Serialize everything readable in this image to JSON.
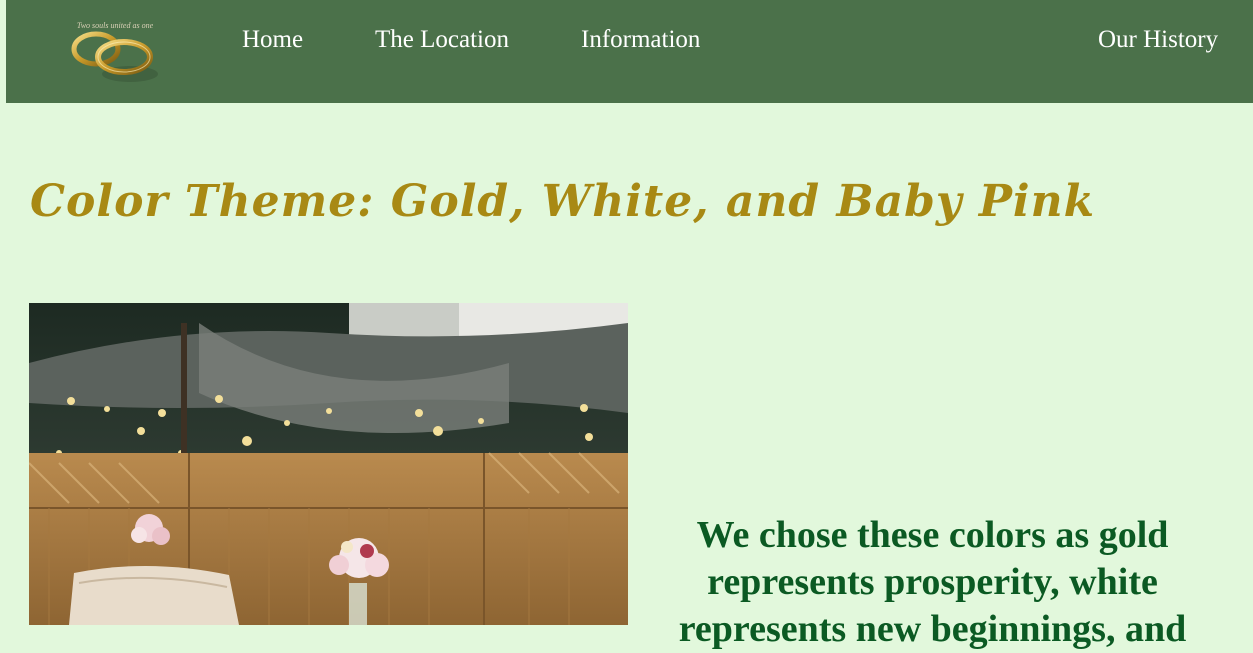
{
  "logo": {
    "caption": "Two souls united as one",
    "icon": "wedding-rings-icon"
  },
  "nav": {
    "home": "Home",
    "location": "The Location",
    "information": "Information",
    "history": "Our History"
  },
  "page": {
    "title": "Color Theme: Gold, White, and Baby Pink",
    "description": "We chose these colors as gold represents prosperity, white represents new beginnings, and"
  },
  "colors": {
    "navbar": "#4b714a",
    "background": "#e2f8dc",
    "title": "#a88914",
    "description": "#0b5a23"
  }
}
